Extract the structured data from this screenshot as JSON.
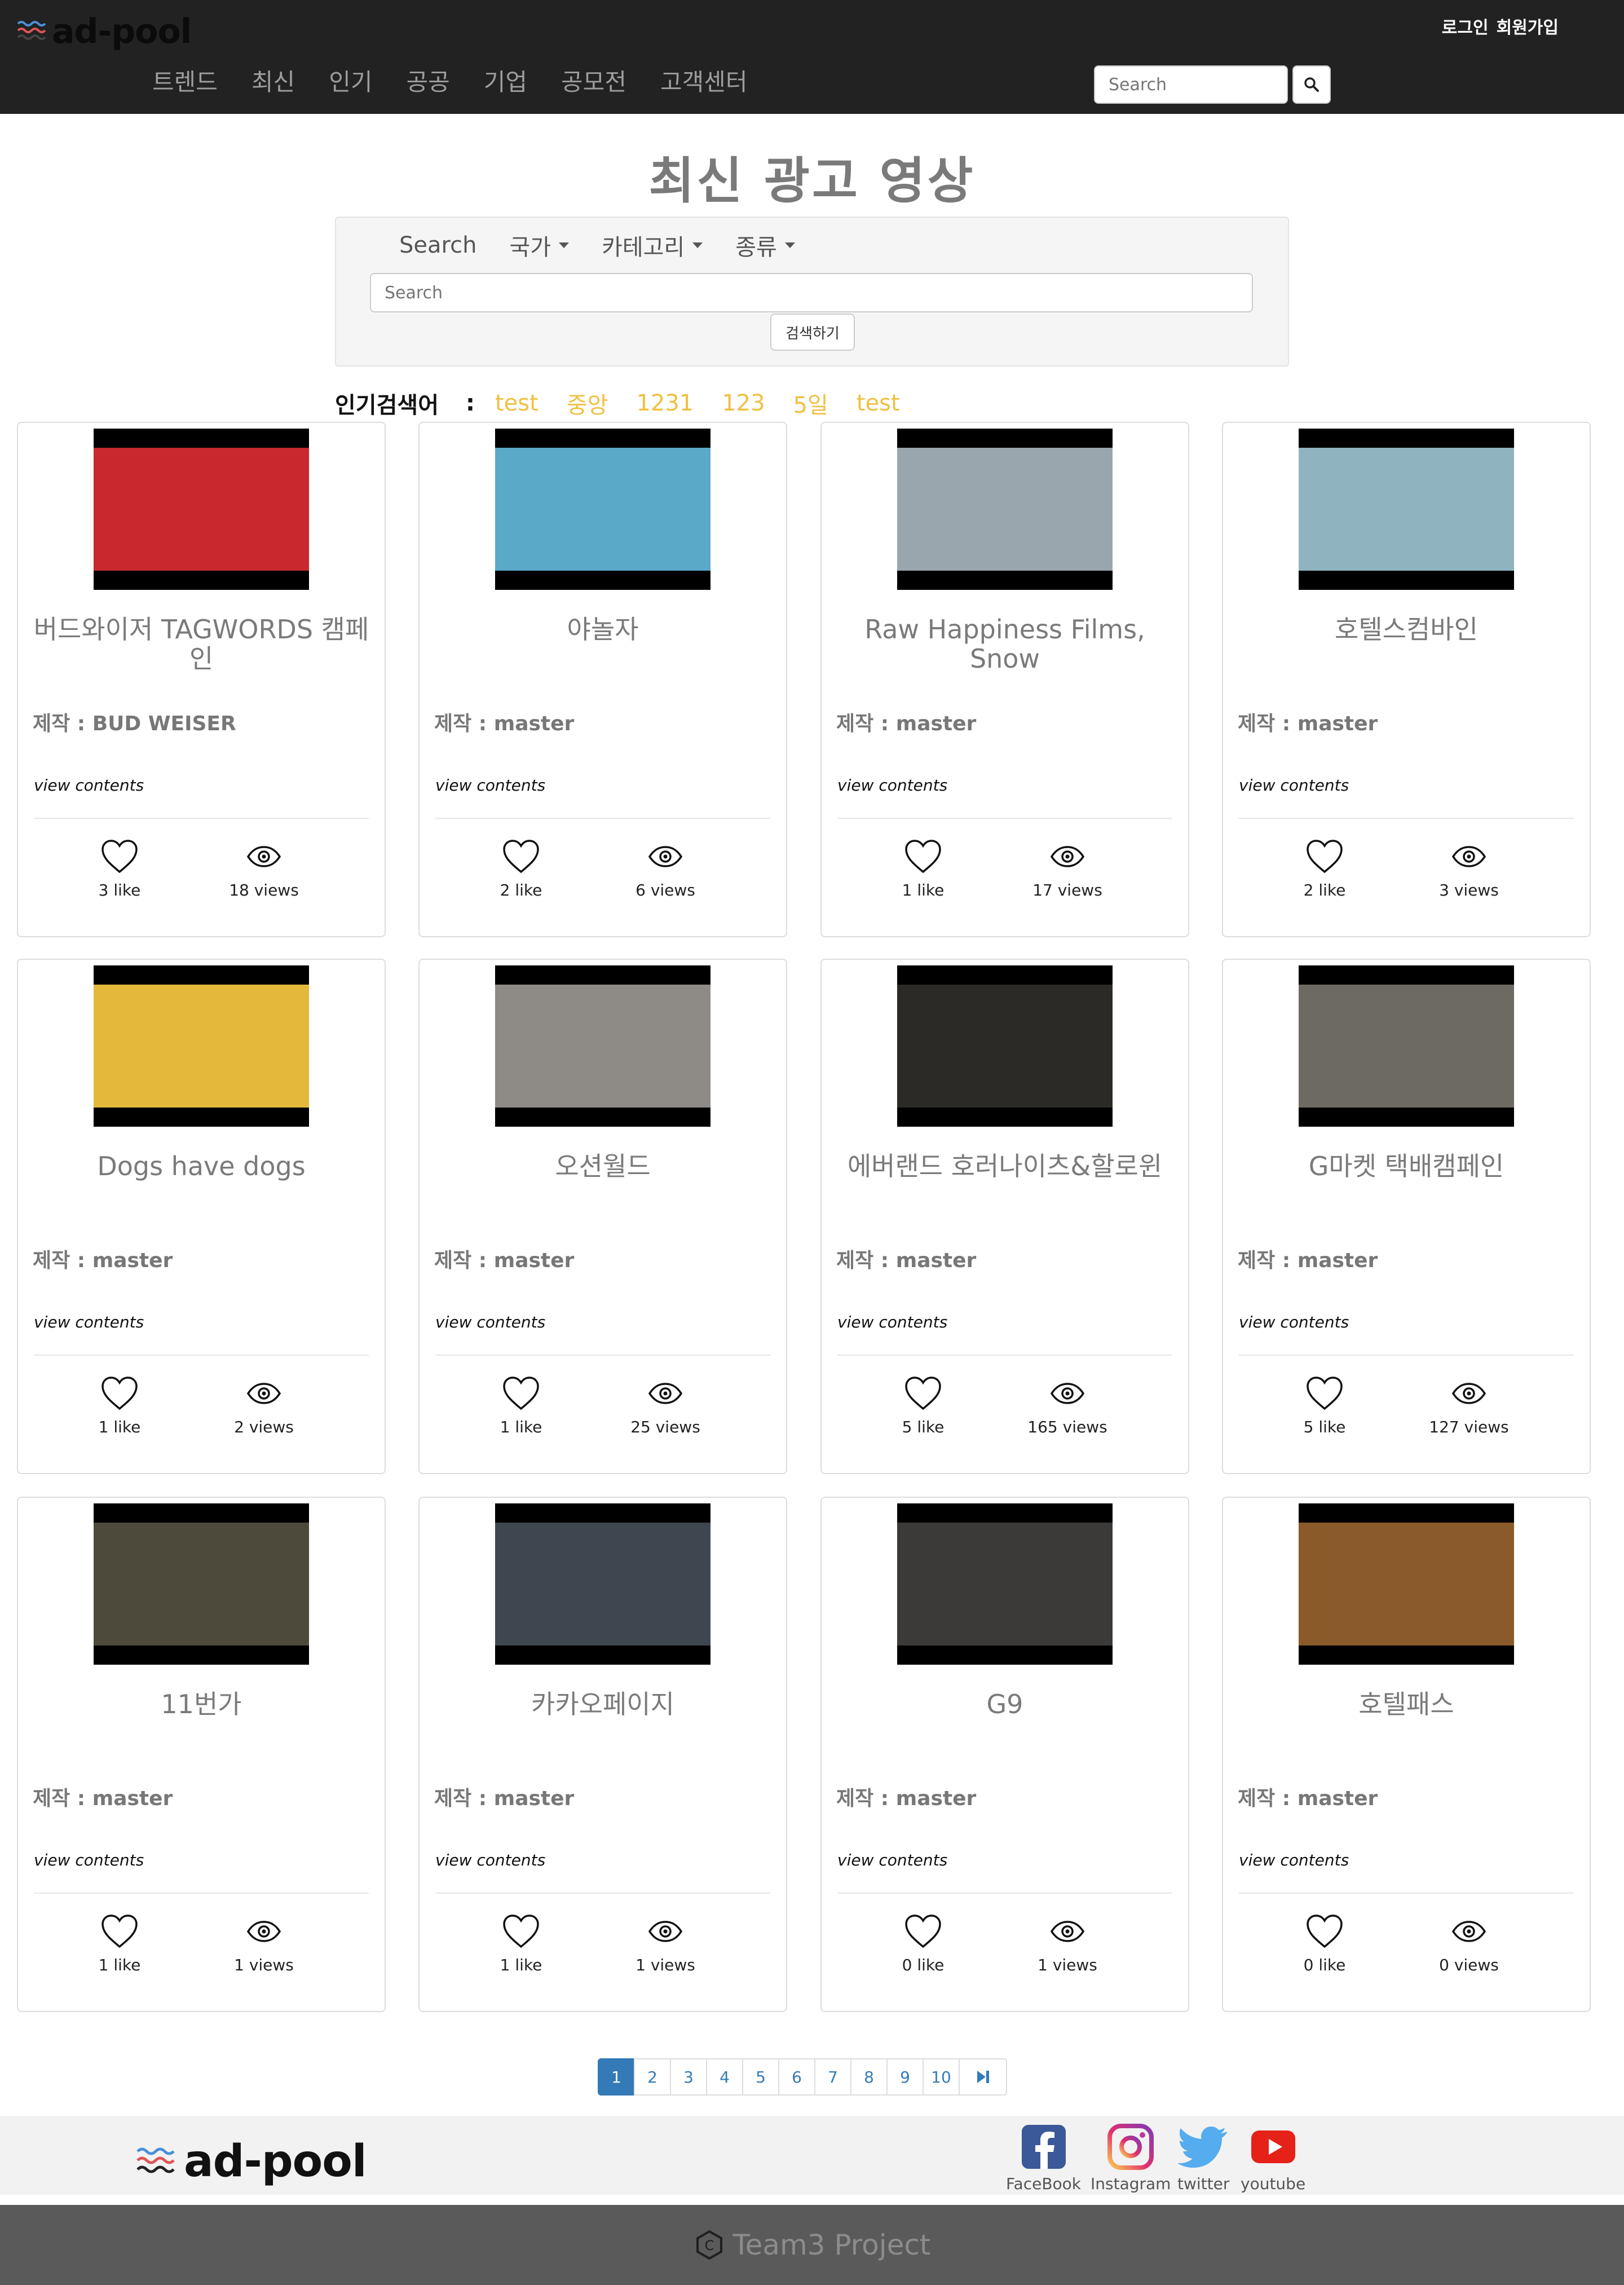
{
  "header": {
    "brand": "ad-pool",
    "login": "로그인",
    "signup": "회원가입",
    "nav": [
      "트렌드",
      "최신",
      "인기",
      "공공",
      "기업",
      "공모전",
      "고객센터"
    ],
    "search_placeholder": "Search"
  },
  "main": {
    "title": "최신 광고 영상",
    "filters": {
      "search_label": "Search",
      "country": "국가",
      "category": "카테고리",
      "type": "종류"
    },
    "search_placeholder": "Search",
    "search_button": "검색하기",
    "popular_label": "인기검색어",
    "popular_colon": ":",
    "popular_keywords": [
      "test",
      "중앙",
      "1231",
      "123",
      "5일",
      "test"
    ]
  },
  "cards": [
    {
      "title": "버드와이저 TAGWORDS 캠페인",
      "maker_label": "제작 : ",
      "maker": "BUD WEISER",
      "view": "view contents",
      "likes": "3 like",
      "views": "18 views",
      "thumb_color": "#c8282e"
    },
    {
      "title": "야놀자",
      "maker_label": "제작 : ",
      "maker": "master",
      "view": "view contents",
      "likes": "2 like",
      "views": "6 views",
      "thumb_color": "#5aa9c9"
    },
    {
      "title": "Raw Happiness Films, Snow",
      "maker_label": "제작 : ",
      "maker": "master",
      "view": "view contents",
      "likes": "1 like",
      "views": "17 views",
      "thumb_color": "#9aa6ad"
    },
    {
      "title": "호텔스컴바인",
      "maker_label": "제작 : ",
      "maker": "master",
      "view": "view contents",
      "likes": "2 like",
      "views": "3 views",
      "thumb_color": "#8fb4bf"
    },
    {
      "title": "Dogs have dogs",
      "maker_label": "제작 : ",
      "maker": "master",
      "view": "view contents",
      "likes": "1 like",
      "views": "2 views",
      "thumb_color": "#e3b93b"
    },
    {
      "title": "오션월드",
      "maker_label": "제작 : ",
      "maker": "master",
      "view": "view contents",
      "likes": "1 like",
      "views": "25 views",
      "thumb_color": "#8e8a86"
    },
    {
      "title": "에버랜드 호러나이츠&할로윈",
      "maker_label": "제작 : ",
      "maker": "master",
      "view": "view contents",
      "likes": "5 like",
      "views": "165 views",
      "thumb_color": "#2b2a26"
    },
    {
      "title": "G마켓 택배캠페인",
      "maker_label": "제작 : ",
      "maker": "master",
      "view": "view contents",
      "likes": "5 like",
      "views": "127 views",
      "thumb_color": "#6c6a62"
    },
    {
      "title": "11번가",
      "maker_label": "제작 : ",
      "maker": "master",
      "view": "view contents",
      "likes": "1 like",
      "views": "1 views",
      "thumb_color": "#4d4a3c"
    },
    {
      "title": "카카오페이지",
      "maker_label": "제작 : ",
      "maker": "master",
      "view": "view contents",
      "likes": "1 like",
      "views": "1 views",
      "thumb_color": "#3e4650"
    },
    {
      "title": "G9",
      "maker_label": "제작 : ",
      "maker": "master",
      "view": "view contents",
      "likes": "0 like",
      "views": "1 views",
      "thumb_color": "#3c3a38"
    },
    {
      "title": "호텔패스",
      "maker_label": "제작 : ",
      "maker": "master",
      "view": "view contents",
      "likes": "0 like",
      "views": "0 views",
      "thumb_color": "#8a5a2a"
    }
  ],
  "pagination": {
    "pages": [
      "1",
      "2",
      "3",
      "4",
      "5",
      "6",
      "7",
      "8",
      "9",
      "10"
    ],
    "active": "1",
    "last_icon": "skip-to-last-icon"
  },
  "footer": {
    "brand": "ad-pool",
    "social": [
      {
        "label": "FaceBook",
        "icon": "facebook-icon",
        "color": "#3b5998"
      },
      {
        "label": "Instagram",
        "icon": "instagram-icon",
        "color": "#c13584"
      },
      {
        "label": "twitter",
        "icon": "twitter-icon",
        "color": "#55acee"
      },
      {
        "label": "youtube",
        "icon": "youtube-icon",
        "color": "#e62117"
      }
    ],
    "copyright": "Team3 Project"
  }
}
